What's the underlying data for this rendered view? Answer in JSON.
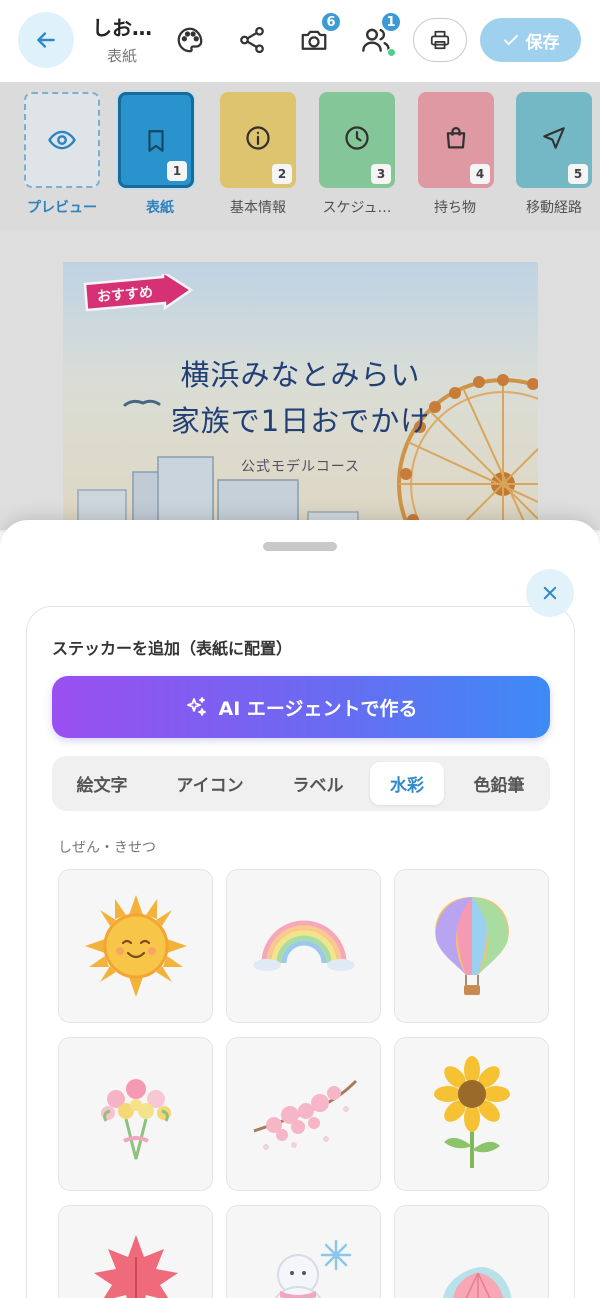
{
  "header": {
    "title": "しお…",
    "subtitle": "表紙",
    "camera_badge": "6",
    "members_badge": "1",
    "save_label": "保存"
  },
  "tabs": [
    {
      "label": "プレビュー",
      "number": "",
      "icon": "eye-icon",
      "color": "#e4e4e4"
    },
    {
      "label": "表紙",
      "number": "1",
      "icon": "bookmark-icon",
      "color": "#2a9ad6"
    },
    {
      "label": "基本情報",
      "number": "2",
      "icon": "info-icon",
      "color": "#e8cd73"
    },
    {
      "label": "スケジュ…",
      "number": "3",
      "icon": "clock-icon",
      "color": "#8bcfa0"
    },
    {
      "label": "持ち物",
      "number": "4",
      "icon": "bag-icon",
      "color": "#e8a0aa"
    },
    {
      "label": "移動経路",
      "number": "5",
      "icon": "navigation-icon",
      "color": "#79c0cf"
    }
  ],
  "cover": {
    "badge": "おすすめ",
    "title_line1": "横浜みなとみらい",
    "title_line2": "家族で1日おでかけ",
    "subtitle": "公式モデルコース"
  },
  "sheet": {
    "panel_title": "ステッカーを追加（表紙に配置）",
    "ai_button": "AI エージェントで作る",
    "segments": [
      "絵文字",
      "アイコン",
      "ラベル",
      "水彩",
      "色鉛筆"
    ],
    "active_segment": "水彩",
    "category_label": "しぜん・きせつ",
    "stickers": [
      "sun-sticker",
      "rainbow-sticker",
      "hot-air-balloon-sticker",
      "flower-bouquet-sticker",
      "cherry-blossom-sticker",
      "sunflower-sticker",
      "maple-leaf-sticker",
      "snowman-sticker",
      "seashell-sticker"
    ]
  }
}
